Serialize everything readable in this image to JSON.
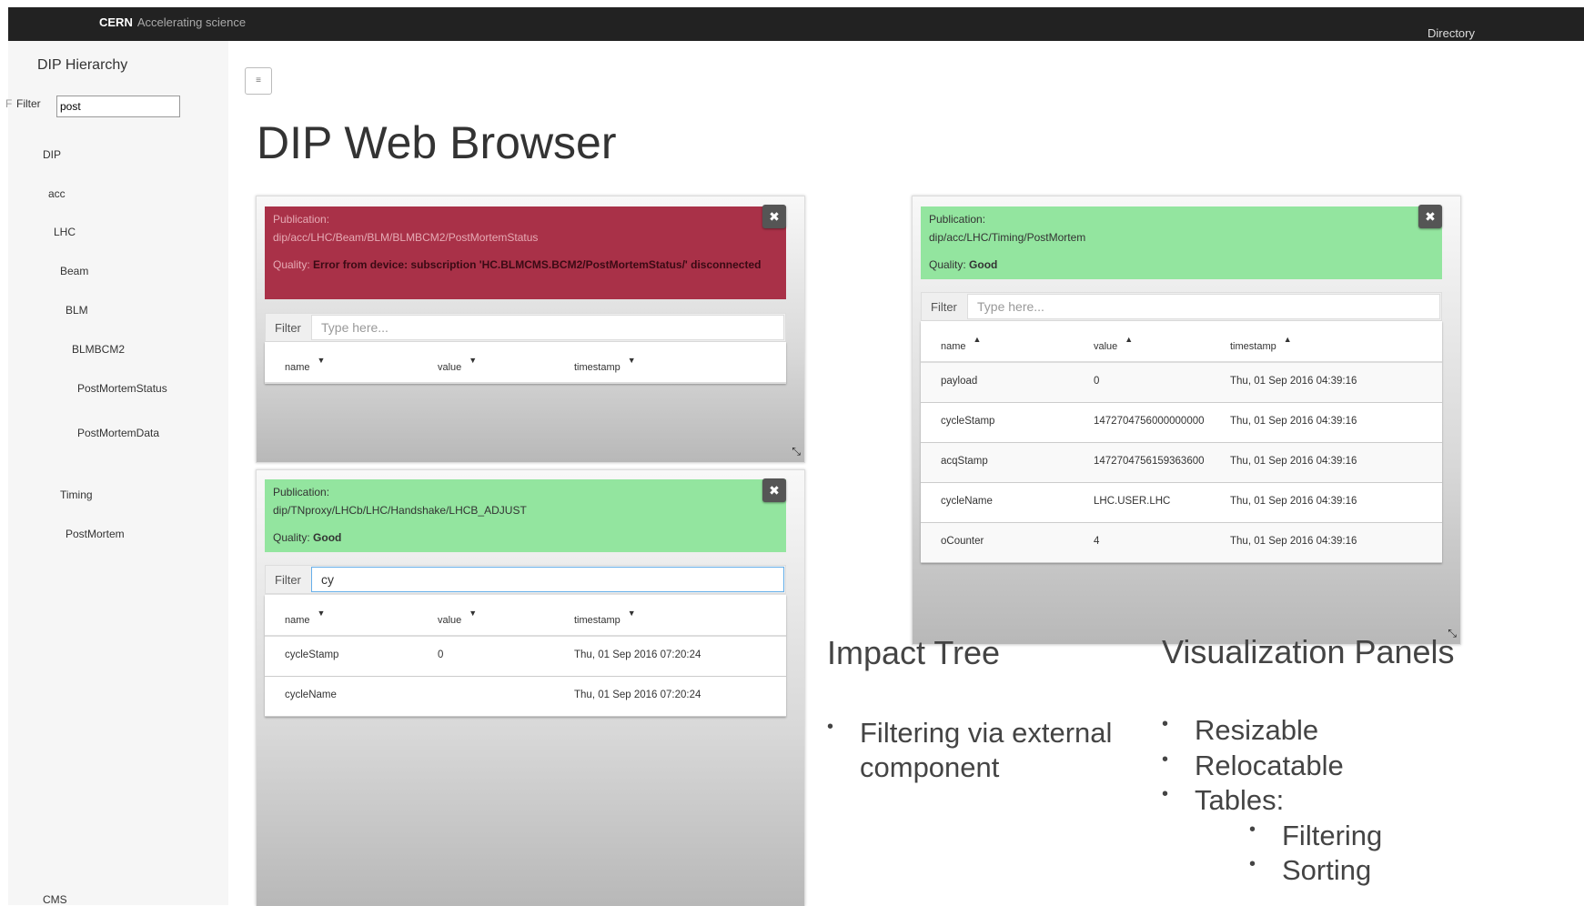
{
  "topbar": {
    "brand": "CERN",
    "tagline": "Accelerating science",
    "directory": "Directory"
  },
  "sidebar": {
    "title": "DIP Hierarchy",
    "filter_label": "Filter",
    "filter_value": "post",
    "tree": [
      "DIP",
      "acc",
      "LHC",
      "Beam",
      "BLM",
      "BLMBCM2",
      "PostMortemStatus",
      "PostMortemData",
      "Timing",
      "PostMortem",
      "CMS"
    ]
  },
  "page": {
    "title": "DIP Web Browser",
    "menu_icon": "≡"
  },
  "panels": {
    "p1": {
      "pub_label": "Publication:",
      "pub_path": "dip/acc/LHC/Beam/BLM/BLMBCM2/PostMortemStatus",
      "quality_label": "Quality:",
      "quality_value": "Error from device: subscription 'HC.BLMCMS.BCM2/PostMortemStatus/' disconnected",
      "filter_label": "Filter",
      "filter_placeholder": "Type here...",
      "columns": [
        "name",
        "value",
        "timestamp"
      ]
    },
    "p2": {
      "pub_label": "Publication:",
      "pub_path": "dip/TNproxy/LHCb/LHC/Handshake/LHCB_ADJUST",
      "quality_label": "Quality:",
      "quality_value": "Good",
      "filter_label": "Filter",
      "filter_value": "cy",
      "columns": [
        "name",
        "value",
        "timestamp"
      ],
      "rows": [
        [
          "cycleStamp",
          "0",
          "Thu, 01 Sep 2016 07:20:24"
        ],
        [
          "cycleName",
          "",
          "Thu, 01 Sep 2016 07:20:24"
        ]
      ]
    },
    "p3": {
      "pub_label": "Publication:",
      "pub_path": "dip/acc/LHC/Timing/PostMortem",
      "quality_label": "Quality:",
      "quality_value": "Good",
      "filter_label": "Filter",
      "filter_placeholder": "Type here...",
      "columns": [
        "name",
        "value",
        "timestamp"
      ],
      "rows": [
        [
          "payload",
          "0",
          "Thu, 01 Sep 2016 04:39:16"
        ],
        [
          "cycleStamp",
          "1472704756000000000",
          "Thu, 01 Sep 2016 04:39:16"
        ],
        [
          "acqStamp",
          "1472704756159363600",
          "Thu, 01 Sep 2016 04:39:16"
        ],
        [
          "cycleName",
          "LHC.USER.LHC",
          "Thu, 01 Sep 2016 04:39:16"
        ],
        [
          "oCounter",
          "4",
          "Thu, 01 Sep 2016 04:39:16"
        ]
      ]
    }
  },
  "slide": {
    "impact_title": "Impact Tree",
    "impact_bullets": [
      "Filtering via external",
      "component"
    ],
    "viz_title": "Visualization Panels",
    "viz_bullets": [
      "Resizable",
      "Relocatable",
      "Tables:"
    ],
    "viz_sub_bullets": [
      "Filtering",
      "Sorting"
    ],
    "bullet_char": "•"
  },
  "colors": {
    "error": "#a93148",
    "good": "#93e59f",
    "topbar": "#222222"
  }
}
